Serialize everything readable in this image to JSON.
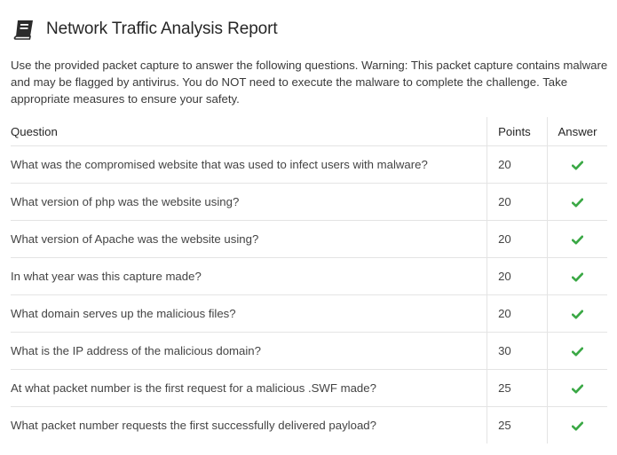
{
  "header": {
    "icon": "book-icon",
    "title": "Network Traffic Analysis Report"
  },
  "description": "Use the provided packet capture to answer the following questions. Warning: This packet capture contains malware and may be flagged by antivirus. You do NOT need to execute the malware to complete the challenge. Take appropriate measures to ensure your safety.",
  "table": {
    "columns": [
      "Question",
      "Points",
      "Answer"
    ],
    "rows": [
      {
        "question": "What was the compromised website that was used to infect users with malware?",
        "points": "20",
        "answer_icon": "check-icon"
      },
      {
        "question": "What version of php was the website using?",
        "points": "20",
        "answer_icon": "check-icon"
      },
      {
        "question": "What version of Apache was the website using?",
        "points": "20",
        "answer_icon": "check-icon"
      },
      {
        "question": "In what year was this capture made?",
        "points": "20",
        "answer_icon": "check-icon"
      },
      {
        "question": "What domain serves up the malicious files?",
        "points": "20",
        "answer_icon": "check-icon"
      },
      {
        "question": "What is the IP address of the malicious domain?",
        "points": "30",
        "answer_icon": "check-icon"
      },
      {
        "question": "At what packet number is the first request for a malicious .SWF made?",
        "points": "25",
        "answer_icon": "check-icon"
      },
      {
        "question": "What packet number requests the first successfully delivered payload?",
        "points": "25",
        "answer_icon": "check-icon"
      }
    ]
  },
  "colors": {
    "check": "#3aa845",
    "icon": "#2b2b2b",
    "border": "#e4e4e4"
  }
}
